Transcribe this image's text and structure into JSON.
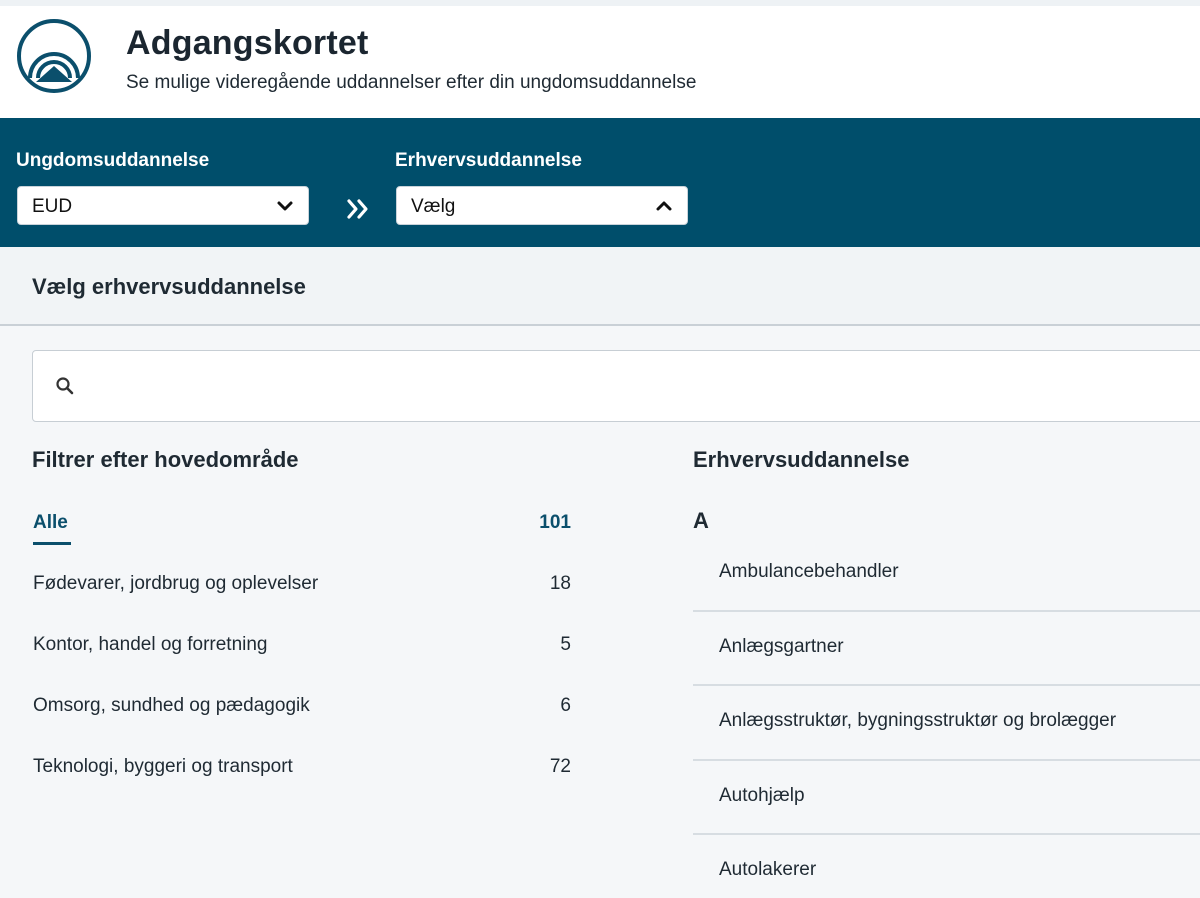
{
  "header": {
    "title": "Adgangskortet",
    "subtitle": "Se mulige videregående uddannelser efter din ungdomsuddannelse",
    "logo_icon": "rainbow-arch-logo-icon"
  },
  "filters": {
    "youth_label": "Ungdomsuddannelse",
    "youth_value": "EUD",
    "vocational_label": "Erhvervsuddannelse",
    "vocational_value": "Vælg",
    "arrow_icon": "double-chevron-right-icon",
    "bar_color": "#004e6b"
  },
  "panel": {
    "heading": "Vælg erhvervsuddannelse",
    "search": {
      "placeholder": "",
      "value": ""
    }
  },
  "categories": {
    "title": "Filtrer efter hovedområde",
    "items": [
      {
        "label": "Alle",
        "count": "101",
        "active": true
      },
      {
        "label": "Fødevarer, jordbrug og oplevelser",
        "count": "18"
      },
      {
        "label": "Kontor, handel og forretning",
        "count": "5"
      },
      {
        "label": "Omsorg, sundhed og pædagogik",
        "count": "6"
      },
      {
        "label": "Teknologi, byggeri og transport",
        "count": "72"
      }
    ]
  },
  "educations": {
    "title": "Erhvervsuddannelse",
    "group_letter": "A",
    "items": [
      "Ambulancebehandler",
      "Anlægsgartner",
      "Anlægsstruktør, bygningsstruktør og brolægger",
      "Autohjælp",
      "Autolakerer"
    ]
  }
}
